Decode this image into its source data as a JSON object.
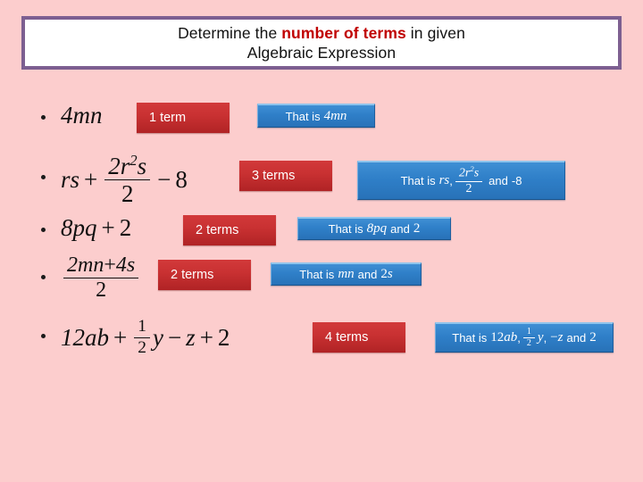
{
  "theme": {
    "background": "#fccdcd",
    "title_border": "#7d5f91",
    "title_fill": "#ffffff",
    "highlight_text": "#c00000",
    "badge_red": "#c93132",
    "badge_blue": "#2f7fc8"
  },
  "title": {
    "line1_before": "Determine the ",
    "line1_highlight": "number of terms",
    "line1_after": " in given",
    "line2": "Algebraic Expression"
  },
  "rows": [
    {
      "expression_text": "4mn",
      "count_label": "1 term",
      "answer_prefix": "That is",
      "answer_text": "4mn"
    },
    {
      "expression_text": "rs + 2r²s/2 − 8",
      "count_label": "3 terms",
      "answer_prefix": "That is",
      "answer_text": "rs, 2r²s/2 and -8"
    },
    {
      "expression_text": "8pq + 2",
      "count_label": "2 terms",
      "answer_prefix": "That is",
      "answer_text": "8pq and 2"
    },
    {
      "expression_text": "(2mn+4s)/2",
      "count_label": "2 terms",
      "answer_prefix": "That is",
      "answer_text": "mn and 2s"
    },
    {
      "expression_text": "12ab + ½y − z + 2",
      "count_label": "4 terms",
      "answer_prefix": "That is",
      "answer_text": "12ab, ½y, −z and 2"
    }
  ],
  "symbols": {
    "plus": "+",
    "minus": "−",
    "comma": ",",
    "and": "and",
    "two": "2",
    "eight": "8",
    "neg_eight": "-8"
  }
}
